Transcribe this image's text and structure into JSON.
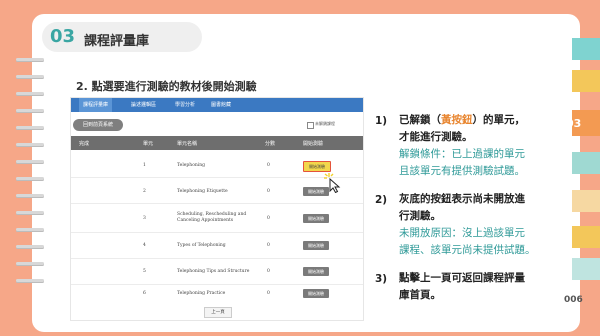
{
  "header": {
    "number": "03",
    "title": "課程評量庫"
  },
  "step": "2. 點選要進行測驗的教材後開始測驗",
  "screenshot": {
    "nav": [
      "課程評量庫",
      "論述邏輯區",
      "學習分析",
      "圖書館藏"
    ],
    "back_button": "回到前頁系統",
    "checkbox_label": "未解鎖課程",
    "columns": [
      "完成",
      "單元",
      "單元名稱",
      "分數",
      "開始測驗"
    ],
    "rows": [
      {
        "unit": "1",
        "name": "Telephoning",
        "score": "0",
        "button": "開始測驗"
      },
      {
        "unit": "2",
        "name": "Telephoning Etiquette",
        "score": "0",
        "button": "開始測驗"
      },
      {
        "unit": "3",
        "name": "Scheduling, Rescheduling and Canceling Appointments",
        "score": "0",
        "button": "開始測驗"
      },
      {
        "unit": "4",
        "name": "Types of Telephoning",
        "score": "0",
        "button": "開始測驗"
      },
      {
        "unit": "5",
        "name": "Telephoning Tips and Structure",
        "score": "0",
        "button": "開始測驗"
      },
      {
        "unit": "6",
        "name": "Telephoning Practice",
        "score": "0",
        "button": "開始測驗"
      }
    ],
    "prev_button": "上一頁"
  },
  "notes": {
    "n1_num": "1)",
    "n1_a": "已解鎖（",
    "n1_hl": "黃按鈕",
    "n1_b": "）的單元，",
    "n1_c": "才能進行測驗。",
    "n1_d": "解鎖條件：已上過課的單元",
    "n1_e": "且該單元有提供測驗試題。",
    "n2_num": "2)",
    "n2_a": "灰底的按鈕表示尚未開放進",
    "n2_b": "行測驗。",
    "n2_c": "未開放原因：沒上過該單元",
    "n2_d": "課程、該單元尚未提供試題。",
    "n3_num": "3)",
    "n3_a": "點擊上一頁可返回課程評量",
    "n3_b": "庫首頁。"
  },
  "side_tabs": {
    "active": "03",
    "page": "006"
  },
  "colors": {
    "background": "#f6a788",
    "teal": "#3aa6a3",
    "orange": "#e8852f",
    "nav": "#3b79c2"
  }
}
